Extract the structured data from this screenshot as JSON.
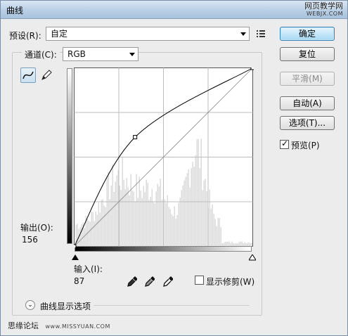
{
  "window": {
    "title": "曲线"
  },
  "watermark_top": {
    "cn": "网页教学网",
    "en": "WEBJX.COM"
  },
  "preset": {
    "label": "预设(R):",
    "value": "自定"
  },
  "channel": {
    "label": "通道(C):",
    "value": "RGB"
  },
  "buttons": {
    "ok": "确定",
    "reset": "复位",
    "smooth": "平滑(M)",
    "auto": "自动(A)",
    "options": "选项(T)..."
  },
  "preview": {
    "label": "预览(P)",
    "checked": true
  },
  "output": {
    "label": "输出(O):",
    "value": "156"
  },
  "input": {
    "label": "输入(I):",
    "value": "87"
  },
  "show_clipping": {
    "label": "显示修剪(W)",
    "checked": false
  },
  "curve_display_options": {
    "label": "曲线显示选项"
  },
  "footer_watermark": {
    "cn": "思缘论坛",
    "url": "www.MISSYUAN.COM"
  },
  "curve": {
    "points": [
      [
        0,
        0
      ],
      [
        87,
        156
      ],
      [
        255,
        255
      ]
    ]
  }
}
